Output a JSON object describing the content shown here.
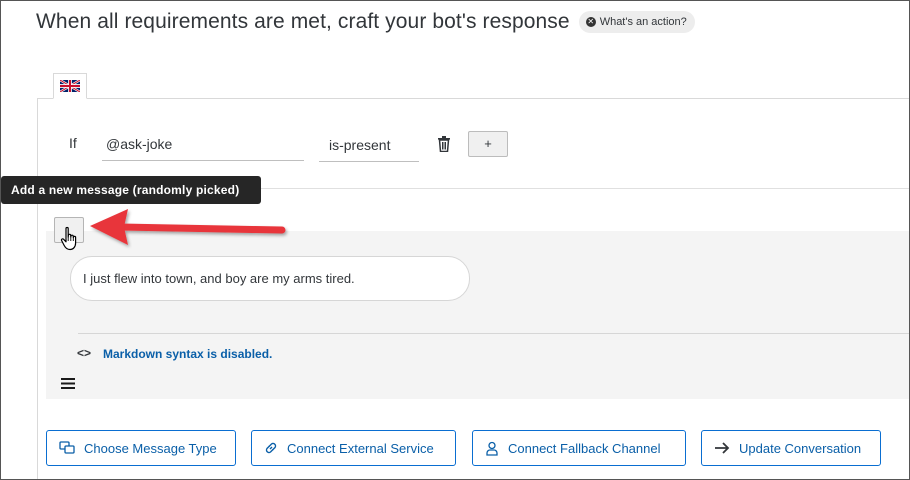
{
  "header": {
    "title": "When all requirements are met, craft your bot's response",
    "help_chip": "What's an action?"
  },
  "language_tab": {
    "flag": "uk-flag-icon"
  },
  "condition": {
    "if_label": "If",
    "entity_value": "@ask-joke",
    "operator_value": "is-present",
    "add_label": "+"
  },
  "tooltip": {
    "text": "Add a new message (randomly picked)"
  },
  "message": {
    "text": "I just flew into town, and boy are my arms tired."
  },
  "markdown": {
    "icon": "<>",
    "text": "Markdown syntax is disabled."
  },
  "actions": {
    "choose_message_type": "Choose Message Type",
    "connect_external_service": "Connect External Service",
    "connect_fallback_channel": "Connect Fallback Channel",
    "update_conversation": "Update Conversation"
  },
  "colors": {
    "accent": "#0a6ed1",
    "link": "#0a5fa8",
    "arrow": "#e8343a",
    "tooltip_bg": "#262626"
  }
}
